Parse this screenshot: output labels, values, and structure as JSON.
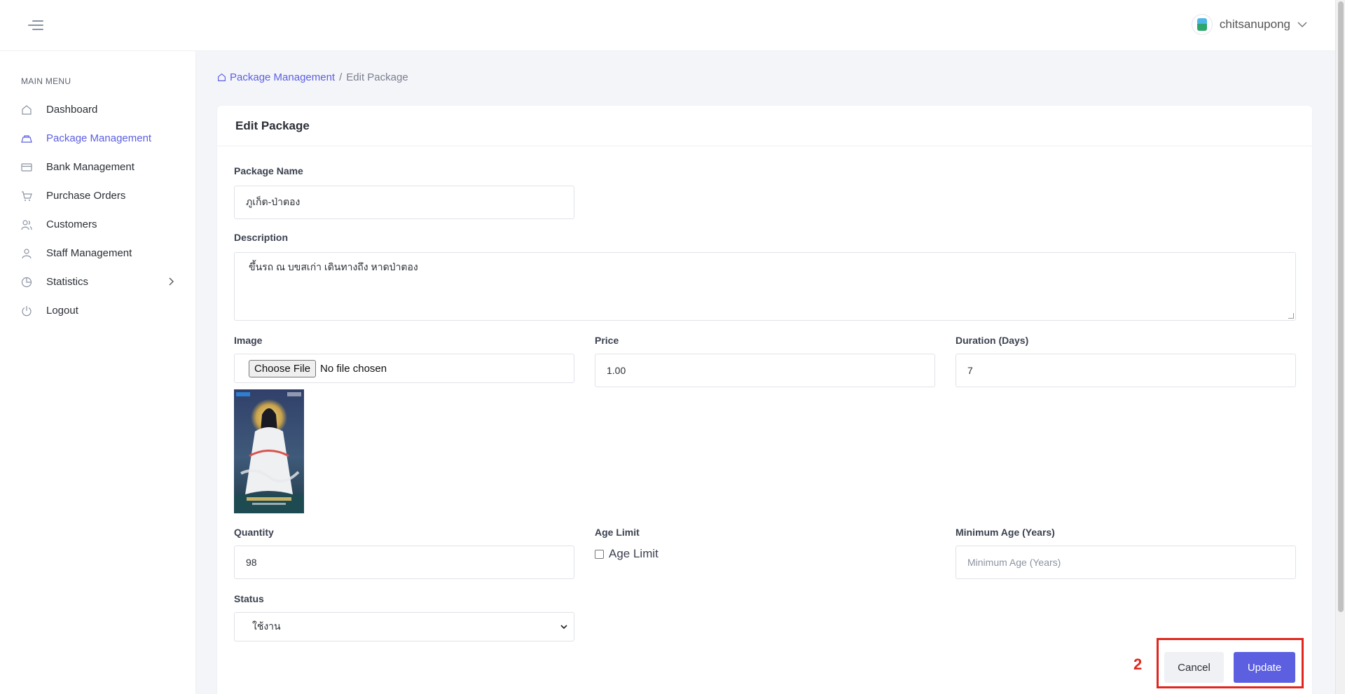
{
  "header": {
    "username": "chitsanupong"
  },
  "sidebar": {
    "menu_label": "MAIN MENU",
    "items": [
      {
        "label": "Dashboard",
        "icon": "home-icon"
      },
      {
        "label": "Package Management",
        "icon": "package-icon",
        "active": true
      },
      {
        "label": "Bank Management",
        "icon": "credit-card-icon"
      },
      {
        "label": "Purchase Orders",
        "icon": "cart-icon"
      },
      {
        "label": "Customers",
        "icon": "users-icon"
      },
      {
        "label": "Staff Management",
        "icon": "user-icon"
      },
      {
        "label": "Statistics",
        "icon": "pie-chart-icon",
        "has_submenu": true
      },
      {
        "label": "Logout",
        "icon": "power-icon"
      }
    ]
  },
  "breadcrumb": {
    "home": "Package Management",
    "separator": "/",
    "current": "Edit Package"
  },
  "form": {
    "title": "Edit Package",
    "package_name": {
      "label": "Package Name",
      "value": "ภูเก็ต-ป่าตอง"
    },
    "description": {
      "label": "Description",
      "value": "ขึ้นรถ ณ บขสเก่า เดินทางถึง หาดป่าตอง"
    },
    "image": {
      "label": "Image",
      "button": "Choose File",
      "status": "No file chosen"
    },
    "price": {
      "label": "Price",
      "value": "1.00"
    },
    "duration": {
      "label": "Duration (Days)",
      "value": "7"
    },
    "quantity": {
      "label": "Quantity",
      "value": "98"
    },
    "age_limit": {
      "label": "Age Limit",
      "checkbox_label": "Age Limit",
      "checked": false
    },
    "minimum_age": {
      "label": "Minimum Age (Years)",
      "placeholder": "Minimum Age (Years)"
    },
    "status": {
      "label": "Status",
      "value": "ใช้งาน"
    }
  },
  "actions": {
    "cancel": "Cancel",
    "update": "Update"
  },
  "annotation": {
    "number": "2",
    "color": "#e0271e"
  },
  "colors": {
    "accent": "#5b5fe0"
  }
}
